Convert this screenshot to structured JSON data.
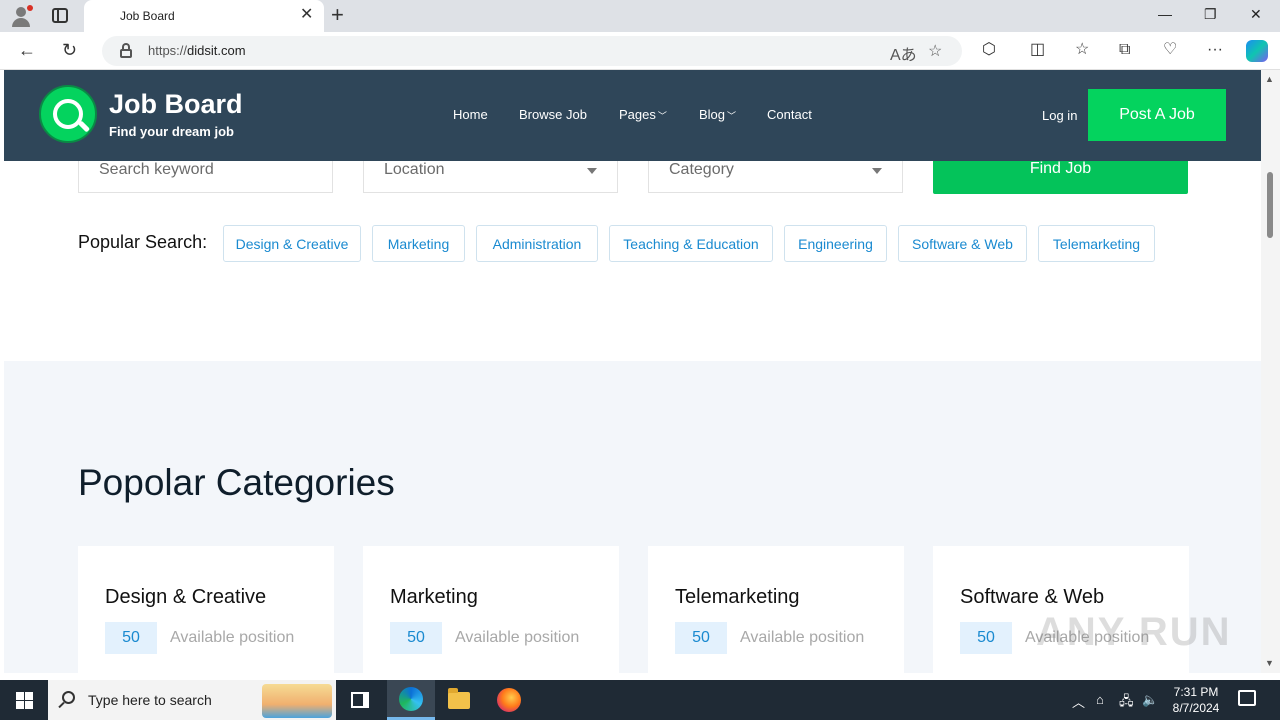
{
  "browser": {
    "tab_title": "Job Board",
    "url_protocol": "https://",
    "url_host": "didsit.com"
  },
  "header": {
    "brand": "Job Board",
    "tagline": "Find your dream job",
    "nav": {
      "home": "Home",
      "browse": "Browse Job",
      "pages": "Pages",
      "blog": "Blog",
      "contact": "Contact"
    },
    "login": "Log in",
    "post_job": "Post A Job"
  },
  "search": {
    "keyword_placeholder": "Search keyword",
    "location_placeholder": "Location",
    "category_placeholder": "Category",
    "find_button": "Find Job"
  },
  "popular": {
    "label": "Popular Search:",
    "tags": [
      "Design & Creative",
      "Marketing",
      "Administration",
      "Teaching & Education",
      "Engineering",
      "Software & Web",
      "Telemarketing"
    ]
  },
  "categories": {
    "title": "Popolar Categories",
    "cards": [
      {
        "name": "Design & Creative",
        "count": "50",
        "label": "Available position"
      },
      {
        "name": "Marketing",
        "count": "50",
        "label": "Available position"
      },
      {
        "name": "Telemarketing",
        "count": "50",
        "label": "Available position"
      },
      {
        "name": "Software & Web",
        "count": "50",
        "label": "Available position"
      }
    ]
  },
  "watermark": "ANY RUN",
  "taskbar": {
    "search_text": "Type here to search",
    "time": "7:31 PM",
    "date": "8/7/2024"
  },
  "colors": {
    "header_bg": "#2f4659",
    "accent_green": "#04d35e",
    "tag_blue": "#1a8ad0",
    "section_bg": "#f3f6fa"
  }
}
